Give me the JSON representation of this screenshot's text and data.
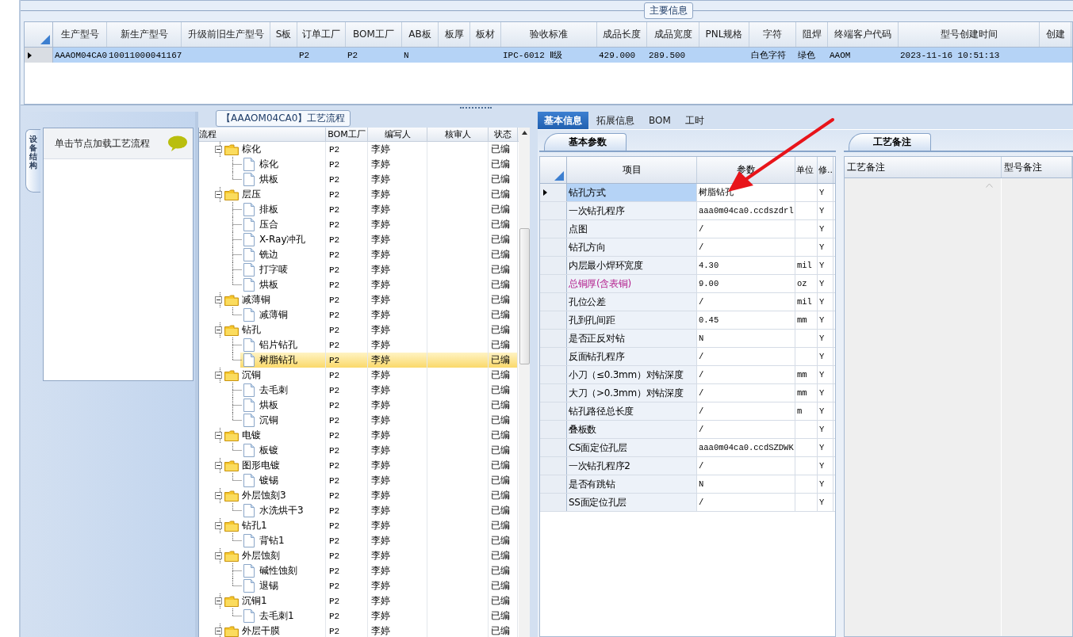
{
  "main_info": {
    "title": "主要信息",
    "columns": [
      "生产型号",
      "新生产型号",
      "升级前旧生产型号",
      "S板",
      "订单工厂",
      "BOM工厂",
      "AB板",
      "板厚",
      "板材",
      "验收标准",
      "成品长度",
      "成品宽度",
      "PNL规格",
      "字符",
      "阻焊",
      "终端客户代码",
      "型号创建时间",
      "创建"
    ],
    "rows": [
      {
        "selected": true,
        "cells": [
          "AAAOM04CA0",
          "10011000041167",
          null,
          null,
          "P2",
          "P2",
          "N",
          null,
          null,
          "IPC-6012 Ⅱ级",
          "429.000",
          "289.500",
          null,
          "白色字符",
          "绿色",
          "AAOM",
          "2023-11-16 10:51:13",
          null
        ]
      }
    ]
  },
  "nav": {
    "tab": "设备结构",
    "hint": "单击节点加载工艺流程"
  },
  "flow": {
    "title": "【AAAOM04CA0】工艺流程",
    "columns": [
      "流程",
      "BOM工厂",
      "编写人",
      "核审人",
      "状态"
    ],
    "rows": [
      {
        "label": "棕化",
        "bom": "P2",
        "writer": "李婷",
        "status": "已编",
        "selected": false,
        "expanded": true,
        "children": [
          {
            "label": "棕化",
            "bom": "P2",
            "writer": "李婷",
            "status": "已编",
            "selected": false
          },
          {
            "label": "烘板",
            "bom": "P2",
            "writer": "李婷",
            "status": "已编",
            "selected": false
          }
        ]
      },
      {
        "label": "层压",
        "bom": "P2",
        "writer": "李婷",
        "status": "已编",
        "selected": false,
        "expanded": true,
        "children": [
          {
            "label": "排板",
            "bom": "P2",
            "writer": "李婷",
            "status": "已编",
            "selected": false
          },
          {
            "label": "压合",
            "bom": "P2",
            "writer": "李婷",
            "status": "已编",
            "selected": false
          },
          {
            "label": "X-Ray冲孔",
            "bom": "P2",
            "writer": "李婷",
            "status": "已编",
            "selected": false
          },
          {
            "label": "铣边",
            "bom": "P2",
            "writer": "李婷",
            "status": "已编",
            "selected": false
          },
          {
            "label": "打字唛",
            "bom": "P2",
            "writer": "李婷",
            "status": "已编",
            "selected": false
          },
          {
            "label": "烘板",
            "bom": "P2",
            "writer": "李婷",
            "status": "已编",
            "selected": false
          }
        ]
      },
      {
        "label": "减薄铜",
        "bom": "P2",
        "writer": "李婷",
        "status": "已编",
        "selected": false,
        "expanded": true,
        "children": [
          {
            "label": "减薄铜",
            "bom": "P2",
            "writer": "李婷",
            "status": "已编",
            "selected": false
          }
        ]
      },
      {
        "label": "钻孔",
        "bom": "P2",
        "writer": "李婷",
        "status": "已编",
        "selected": false,
        "expanded": true,
        "children": [
          {
            "label": "铝片钻孔",
            "bom": "P2",
            "writer": "李婷",
            "status": "已编",
            "selected": false
          },
          {
            "label": "树脂钻孔",
            "bom": "P2",
            "writer": "李婷",
            "status": "已编",
            "selected": true
          }
        ]
      },
      {
        "label": "沉铜",
        "bom": "P2",
        "writer": "李婷",
        "status": "已编",
        "selected": false,
        "expanded": true,
        "children": [
          {
            "label": "去毛刺",
            "bom": "P2",
            "writer": "李婷",
            "status": "已编",
            "selected": false
          },
          {
            "label": "烘板",
            "bom": "P2",
            "writer": "李婷",
            "status": "已编",
            "selected": false
          },
          {
            "label": "沉铜",
            "bom": "P2",
            "writer": "李婷",
            "status": "已编",
            "selected": false
          }
        ]
      },
      {
        "label": "电镀",
        "bom": "P2",
        "writer": "李婷",
        "status": "已编",
        "selected": false,
        "expanded": true,
        "children": [
          {
            "label": "板镀",
            "bom": "P2",
            "writer": "李婷",
            "status": "已编",
            "selected": false
          }
        ]
      },
      {
        "label": "图形电镀",
        "bom": "P2",
        "writer": "李婷",
        "status": "已编",
        "selected": false,
        "expanded": true,
        "children": [
          {
            "label": "镀锡",
            "bom": "P2",
            "writer": "李婷",
            "status": "已编",
            "selected": false
          }
        ]
      },
      {
        "label": "外层蚀刻3",
        "bom": "P2",
        "writer": "李婷",
        "status": "已编",
        "selected": false,
        "expanded": true,
        "children": [
          {
            "label": "水洗烘干3",
            "bom": "P2",
            "writer": "李婷",
            "status": "已编",
            "selected": false
          }
        ]
      },
      {
        "label": "钻孔1",
        "bom": "P2",
        "writer": "李婷",
        "status": "已编",
        "selected": false,
        "expanded": true,
        "children": [
          {
            "label": "背钻1",
            "bom": "P2",
            "writer": "李婷",
            "status": "已编",
            "selected": false
          }
        ]
      },
      {
        "label": "外层蚀刻",
        "bom": "P2",
        "writer": "李婷",
        "status": "已编",
        "selected": false,
        "expanded": true,
        "children": [
          {
            "label": "碱性蚀刻",
            "bom": "P2",
            "writer": "李婷",
            "status": "已编",
            "selected": false
          },
          {
            "label": "退锡",
            "bom": "P2",
            "writer": "李婷",
            "status": "已编",
            "selected": false
          }
        ]
      },
      {
        "label": "沉铜1",
        "bom": "P2",
        "writer": "李婷",
        "status": "已编",
        "selected": false,
        "expanded": true,
        "children": [
          {
            "label": "去毛刺1",
            "bom": "P2",
            "writer": "李婷",
            "status": "已编",
            "selected": false
          }
        ]
      },
      {
        "label": "外层干膜",
        "bom": "P2",
        "writer": "李婷",
        "status": "已编",
        "selected": false,
        "expanded": true
      }
    ]
  },
  "tabs": [
    {
      "label": "基本信息",
      "selected": true
    },
    {
      "label": "拓展信息",
      "selected": false
    },
    {
      "label": "BOM",
      "selected": false
    },
    {
      "label": "工时",
      "selected": false
    }
  ],
  "params": {
    "subtab": "基本参数",
    "columns": [
      "项目",
      "参数",
      "单位",
      "修.."
    ],
    "rows": [
      {
        "item": "钻孔方式",
        "value": "树脂钻孔",
        "unit": null,
        "modified": "Y",
        "selected": true,
        "flagged": false
      },
      {
        "item": "一次钻孔程序",
        "value": "aaa0m04ca0.ccdszdrl",
        "unit": null,
        "modified": "Y",
        "selected": false,
        "flagged": false
      },
      {
        "item": "点图",
        "value": "/",
        "unit": null,
        "modified": "Y",
        "selected": false,
        "flagged": false
      },
      {
        "item": "钻孔方向",
        "value": "/",
        "unit": null,
        "modified": "Y",
        "selected": false,
        "flagged": false
      },
      {
        "item": "内层最小焊环宽度",
        "value": "4.30",
        "unit": "mil",
        "modified": "Y",
        "selected": false,
        "flagged": false
      },
      {
        "item": "总铜厚(含表铜)",
        "value": "9.00",
        "unit": "oz",
        "modified": "Y",
        "selected": false,
        "flagged": true
      },
      {
        "item": "孔位公差",
        "value": "/",
        "unit": "mil",
        "modified": "Y",
        "selected": false,
        "flagged": false
      },
      {
        "item": "孔到孔间距",
        "value": "0.45",
        "unit": "mm",
        "modified": "Y",
        "selected": false,
        "flagged": false
      },
      {
        "item": "是否正反对钻",
        "value": "N",
        "unit": null,
        "modified": "Y",
        "selected": false,
        "flagged": false
      },
      {
        "item": "反面钻孔程序",
        "value": "/",
        "unit": null,
        "modified": "Y",
        "selected": false,
        "flagged": false
      },
      {
        "item": "小刀（≤0.3mm）对钻深度",
        "value": "/",
        "unit": "mm",
        "modified": "Y",
        "selected": false,
        "flagged": false
      },
      {
        "item": "大刀（>0.3mm）对钻深度",
        "value": "/",
        "unit": "mm",
        "modified": "Y",
        "selected": false,
        "flagged": false
      },
      {
        "item": "钻孔路径总长度",
        "value": "/",
        "unit": "m",
        "modified": "Y",
        "selected": false,
        "flagged": false
      },
      {
        "item": "叠板数",
        "value": "/",
        "unit": null,
        "modified": "Y",
        "selected": false,
        "flagged": false
      },
      {
        "item": "CS面定位孔层",
        "value": "aaa0m04ca0.ccdSZDWK",
        "unit": null,
        "modified": "Y",
        "selected": false,
        "flagged": false
      },
      {
        "item": "一次钻孔程序2",
        "value": "/",
        "unit": null,
        "modified": "Y",
        "selected": false,
        "flagged": false
      },
      {
        "item": "是否有跳钻",
        "value": "N",
        "unit": null,
        "modified": "Y",
        "selected": false,
        "flagged": false
      },
      {
        "item": "SS面定位孔层",
        "value": "/",
        "unit": null,
        "modified": "Y",
        "selected": false,
        "flagged": false
      }
    ]
  },
  "notes": {
    "subtab": "工艺备注",
    "columns": [
      "工艺备注",
      "型号备注"
    ]
  }
}
